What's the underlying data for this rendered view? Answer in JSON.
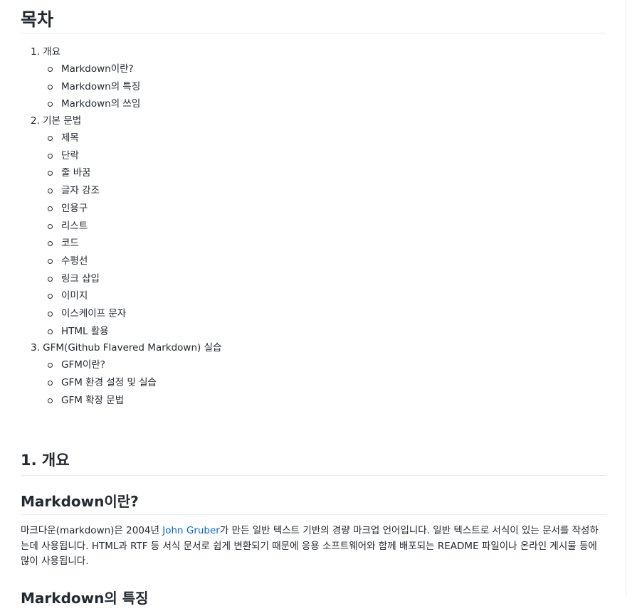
{
  "toc_title": "목차",
  "toc": [
    {
      "label": "1. 개요",
      "items": [
        "Markdown이란?",
        "Markdown의 특징",
        "Markdown의 쓰임"
      ]
    },
    {
      "label": "2. 기본 문법",
      "items": [
        "제목",
        "단락",
        "줄 바꿈",
        "글자 강조",
        "인용구",
        "리스트",
        "코드",
        "수평선",
        "링크 삽입",
        "이미지",
        "이스케이프 문자",
        "HTML 활용"
      ]
    },
    {
      "label": "3. GFM(Github Flavered Markdown) 실습",
      "items": [
        "GFM이란?",
        "GFM 환경 설정 및 실습",
        "GFM 확장 문법"
      ]
    }
  ],
  "section1": {
    "heading": "1. 개요",
    "subheading": "Markdown이란?",
    "para_before_link": "마크다운(markdown)은 2004년 ",
    "link_text": "John Gruber",
    "para_after_link": "가 만든 일반 텍스트 기반의 경량 마크업 언어입니다. 일반 텍스트로 서식이 있는 문서를 작성하는데 사용됩니다. HTML과 RTF 등 서식 문서로 쉽게 변환되기 때문에 응용 소프트웨어와 함께 배포되는 README 파일이나 온라인 게시물 등에 많이 사용됩니다.",
    "next_heading": "Markdown의 특징"
  }
}
